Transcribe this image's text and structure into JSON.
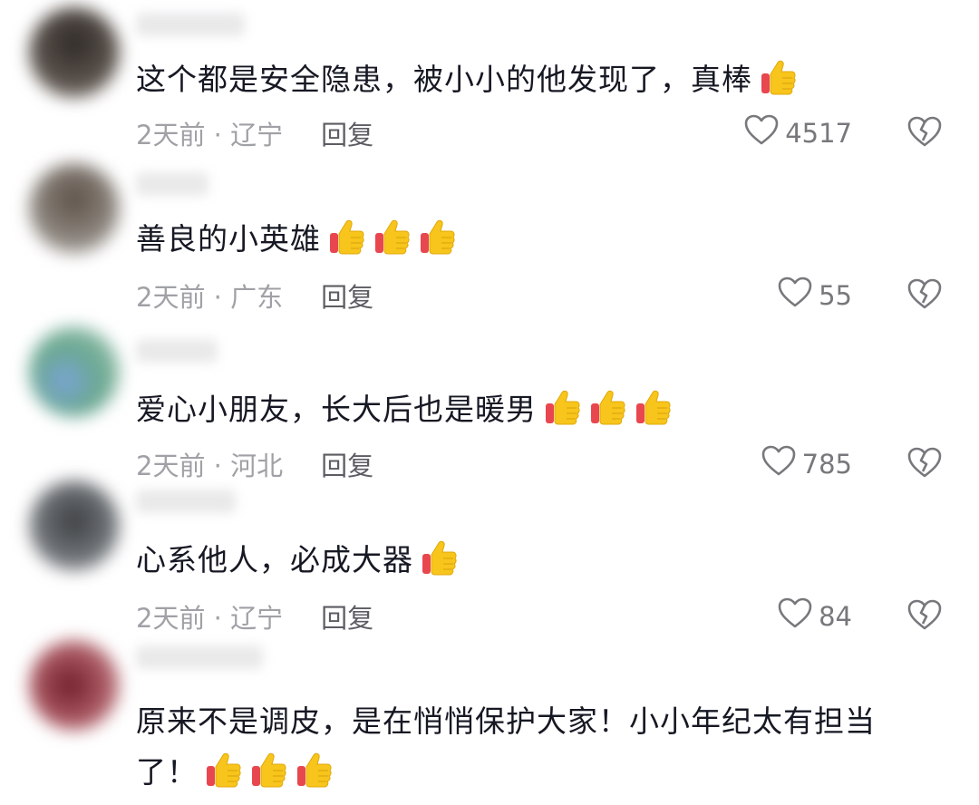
{
  "comments": [
    {
      "text": "这个都是安全隐患，被小小的他发现了，真棒",
      "emoji_count": 1,
      "time": "2天前",
      "sep": " · ",
      "location": "辽宁",
      "reply": "回复",
      "likes": "4517",
      "avatar_color": "#4a4440"
    },
    {
      "text": "善良的小英雄",
      "emoji_count": 3,
      "time": "2天前",
      "sep": " · ",
      "location": "广东",
      "reply": "回复",
      "likes": "55",
      "avatar_color": "#6b6a66"
    },
    {
      "text": "爱心小朋友，长大后也是暖男",
      "emoji_count": 3,
      "time": "2天前",
      "sep": " · ",
      "location": "河北",
      "reply": "回复",
      "likes": "785",
      "avatar_color": "#5f9a8a"
    },
    {
      "text": "心系他人，必成大器",
      "emoji_count": 1,
      "time": "2天前",
      "sep": " · ",
      "location": "辽宁",
      "reply": "回复",
      "likes": "84",
      "avatar_color": "#5a5c5e"
    },
    {
      "text": "原来不是调皮，是在悄悄保护大家！小小年纪太有担当了！",
      "emoji_count": 3,
      "avatar_color": "#8a3a44"
    }
  ],
  "icons": {
    "thumbs_up": "thumbs-up-emoji",
    "like": "heart-outline-icon",
    "dislike": "broken-heart-icon"
  },
  "colors": {
    "text": "#161823",
    "meta": "#a0a1a6",
    "reply": "#5c5d63",
    "emoji": "#f7c51b"
  }
}
